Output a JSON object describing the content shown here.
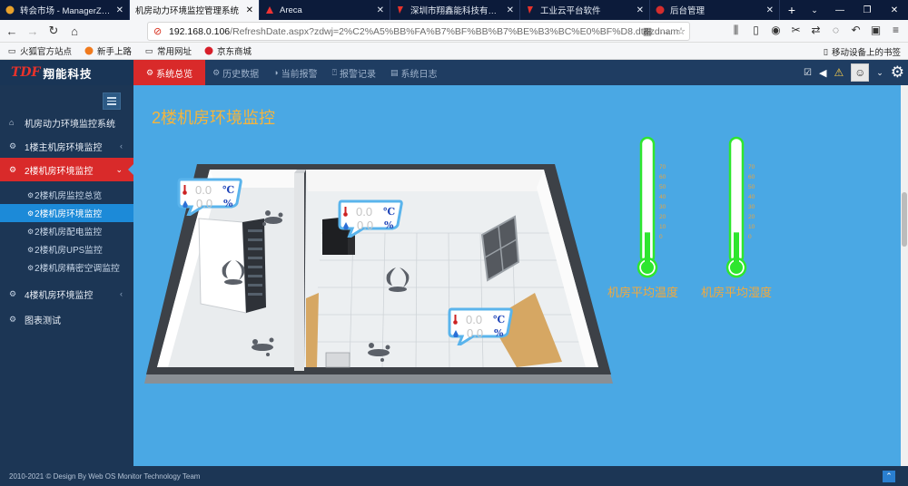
{
  "browser": {
    "tabs": [
      {
        "title": "转会市场 - ManagerZone",
        "icon": "managerzone-icon"
      },
      {
        "title": "机房动力环境监控管理系统",
        "icon": "page-icon"
      },
      {
        "title": "Areca",
        "icon": "areca-icon"
      },
      {
        "title": "深圳市翔鑫能科技有限公司",
        "icon": "brand-icon"
      },
      {
        "title": "工业云平台软件",
        "icon": "brand-icon"
      },
      {
        "title": "后台管理",
        "icon": "huawei-icon"
      }
    ],
    "url_host": "192.168.0.106",
    "url_path": "/RefreshDate.aspx?zdwj=2%C2%A5%BB%FA%B7%BF%BB%B7%BE%B3%BC%E0%BF%D8.dt&zdnam",
    "bookmarks": [
      "火狐官方站点",
      "新手上路",
      "常用网址",
      "京东商城"
    ],
    "mobile_bookmarks": "移动设备上的书签"
  },
  "app": {
    "brand_mark": "TDF",
    "brand_name": "翔能科技",
    "nav": [
      {
        "label": "系统总览",
        "active": true
      },
      {
        "label": "历史数据",
        "active": false
      },
      {
        "label": "当前报警",
        "active": false
      },
      {
        "label": "报警记录",
        "active": false
      },
      {
        "label": "系统日志",
        "active": false
      }
    ],
    "sidebar": {
      "items": [
        {
          "label": "机房动力环境监控系统"
        },
        {
          "label": "1楼主机房环境监控"
        },
        {
          "label": "2楼机房环境监控"
        },
        {
          "label": "4楼机房环境监控"
        },
        {
          "label": "图表测试"
        }
      ],
      "subitems": [
        {
          "label": "2楼机房监控总览"
        },
        {
          "label": "2楼机房环境监控"
        },
        {
          "label": "2楼机房配电监控"
        },
        {
          "label": "2楼机房UPS监控"
        },
        {
          "label": "2楼机房精密空调监控"
        }
      ]
    },
    "page_title": "2楼机房环境监控",
    "sensors": [
      {
        "temp": "0.0",
        "hum": "0.0",
        "temp_unit": "℃",
        "hum_unit": "%"
      },
      {
        "temp": "0.0",
        "hum": "0.0",
        "temp_unit": "℃",
        "hum_unit": "%"
      },
      {
        "temp": "0.0",
        "hum": "0.0",
        "temp_unit": "℃",
        "hum_unit": "%"
      }
    ],
    "thermometers": [
      {
        "label": "机房平均温度",
        "level": 0.18
      },
      {
        "label": "机房平均湿度",
        "level": 0.18
      }
    ],
    "thermo_scale": [
      "70",
      "60",
      "50",
      "40",
      "30",
      "20",
      "10",
      "0"
    ],
    "footer": "2010-2021 © Design By Web OS Monitor Technology Team",
    "colors": {
      "accent": "#d92a2a",
      "main_bg": "#4aa8e4",
      "title": "#f5b43c",
      "thermo_fill": "#2ee62e"
    }
  }
}
